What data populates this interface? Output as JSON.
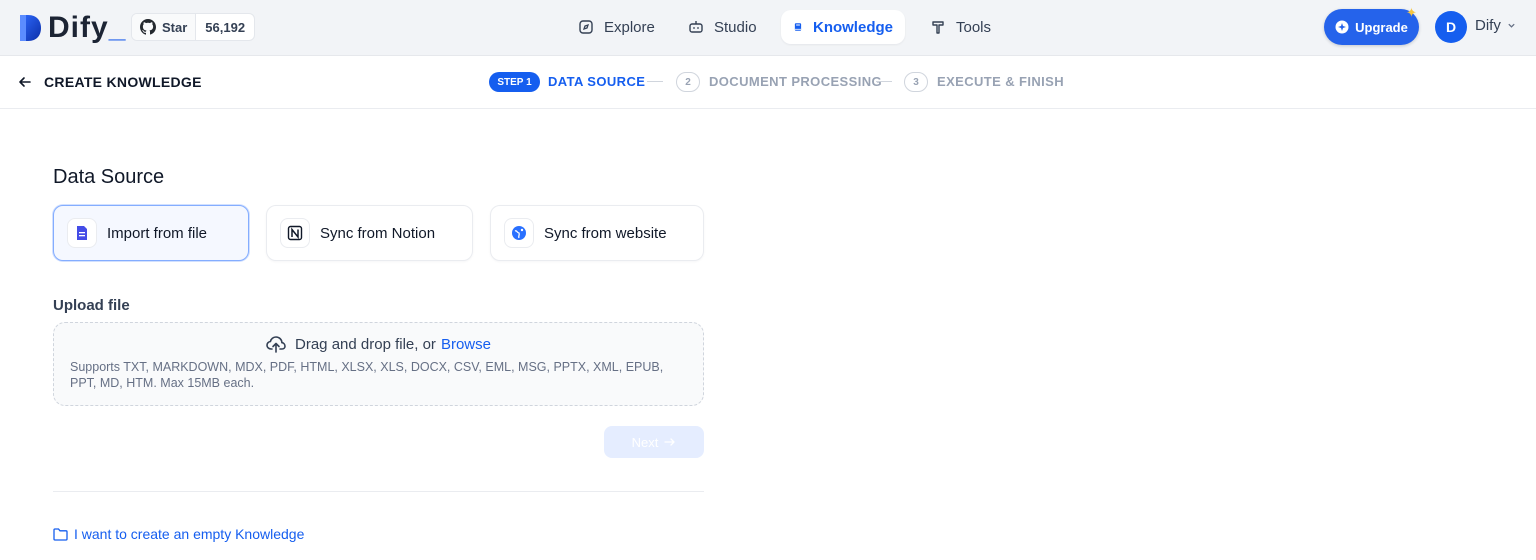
{
  "app": {
    "logo_text": "Dify"
  },
  "github": {
    "star_label": "Star",
    "star_count": "56,192"
  },
  "nav": {
    "explore": "Explore",
    "studio": "Studio",
    "knowledge": "Knowledge",
    "tools": "Tools"
  },
  "account": {
    "upgrade_label": "Upgrade",
    "avatar_initial": "D",
    "user_name": "Dify"
  },
  "header": {
    "back_title": "CREATE KNOWLEDGE"
  },
  "steps": [
    {
      "badge": "STEP 1",
      "label": "DATA SOURCE"
    },
    {
      "badge": "2",
      "label": "DOCUMENT PROCESSING"
    },
    {
      "badge": "3",
      "label": "EXECUTE & FINISH"
    }
  ],
  "main": {
    "section_title": "Data Source",
    "sources": [
      "Import from file",
      "Sync from Notion",
      "Sync from website"
    ],
    "upload_label": "Upload file",
    "drop_text": "Drag and drop file, or",
    "browse_label": "Browse",
    "supports_text": "Supports TXT, MARKDOWN, MDX, PDF, HTML, XLSX, XLS, DOCX, CSV, EML, MSG, PPTX, XML, EPUB, PPT, MD, HTM. Max 15MB each.",
    "next_label": "Next",
    "empty_link": "I want to create an empty Knowledge"
  },
  "colors": {
    "accent": "#155eef",
    "upgrade": "#2563eb"
  }
}
